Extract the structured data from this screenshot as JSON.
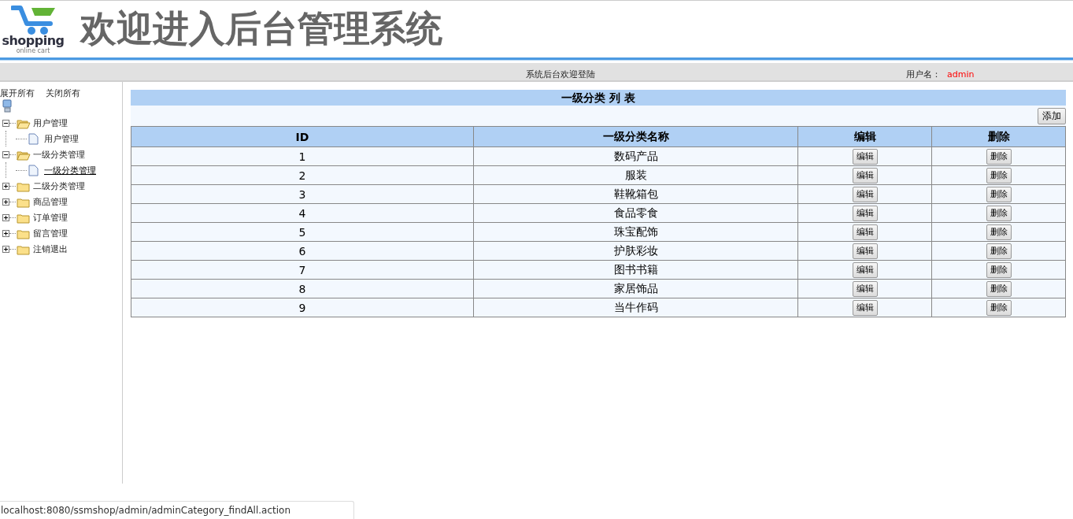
{
  "header": {
    "logo_text": "shopping",
    "logo_subtext": "online cart",
    "title": "欢迎进入后台管理系统"
  },
  "info_bar": {
    "welcome": "系统后台欢迎登陆",
    "user_label": "用户名：",
    "user_name": "admin"
  },
  "tree": {
    "actions": [
      "展开所有",
      "关闭所有"
    ],
    "items": [
      {
        "label": "用户管理",
        "expanded": true,
        "children": [
          {
            "label": "用户管理",
            "selected": false
          }
        ]
      },
      {
        "label": "一级分类管理",
        "expanded": true,
        "children": [
          {
            "label": "一级分类管理",
            "selected": true
          }
        ]
      },
      {
        "label": "二级分类管理",
        "expanded": false
      },
      {
        "label": "商品管理",
        "expanded": false
      },
      {
        "label": "订单管理",
        "expanded": false
      },
      {
        "label": "留言管理",
        "expanded": false
      },
      {
        "label": "注销退出",
        "expanded": false
      }
    ]
  },
  "table": {
    "title": "一级分类 列 表",
    "add_button": "添加",
    "columns": [
      "ID",
      "一级分类名称",
      "编辑",
      "删除"
    ],
    "rows": [
      {
        "id": "1",
        "name": "数码产品",
        "edit": "编辑",
        "delete": "删除"
      },
      {
        "id": "2",
        "name": "服装",
        "edit": "编辑",
        "delete": "删除"
      },
      {
        "id": "3",
        "name": "鞋靴箱包",
        "edit": "编辑",
        "delete": "删除"
      },
      {
        "id": "4",
        "name": "食品零食",
        "edit": "编辑",
        "delete": "删除"
      },
      {
        "id": "5",
        "name": "珠宝配饰",
        "edit": "编辑",
        "delete": "删除"
      },
      {
        "id": "6",
        "name": "护肤彩妆",
        "edit": "编辑",
        "delete": "删除"
      },
      {
        "id": "7",
        "name": "图书书籍",
        "edit": "编辑",
        "delete": "删除"
      },
      {
        "id": "8",
        "name": "家居饰品",
        "edit": "编辑",
        "delete": "删除"
      },
      {
        "id": "9",
        "name": "当牛作码",
        "edit": "编辑",
        "delete": "删除"
      }
    ]
  },
  "status_bar": {
    "url": "localhost:8080/ssmshop/admin/adminCategory_findAll.action"
  }
}
